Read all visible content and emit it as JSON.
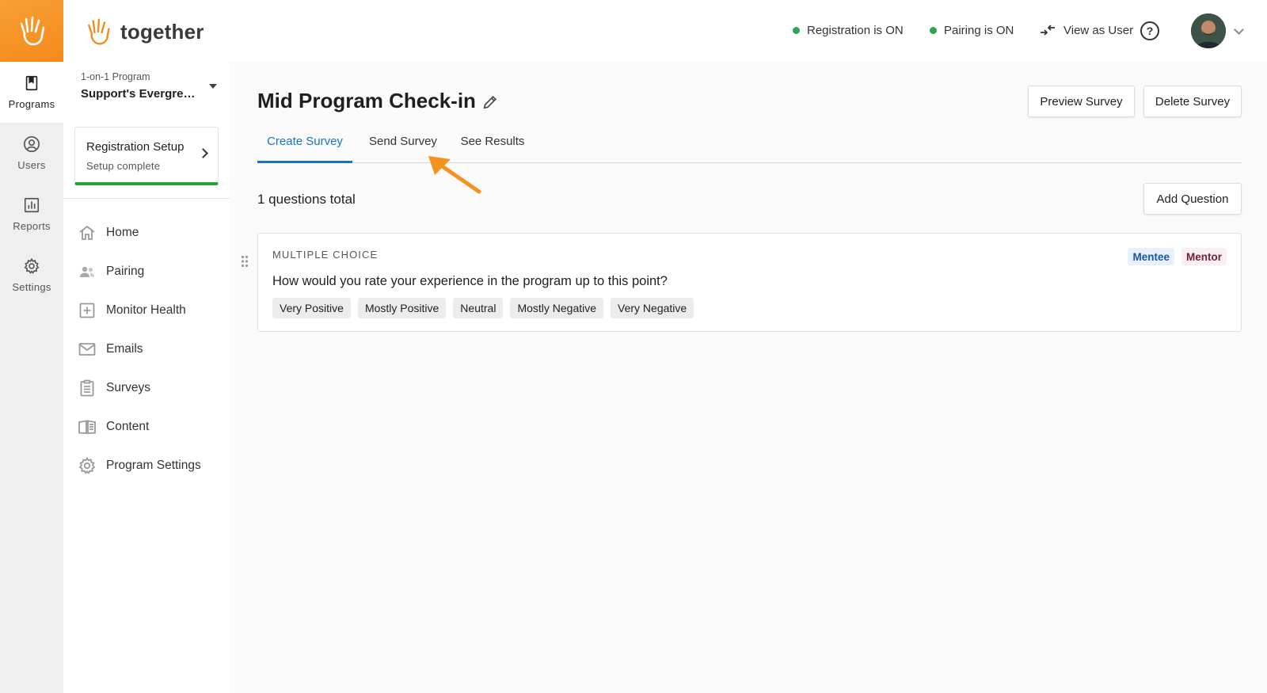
{
  "brand": {
    "name": "together",
    "color": "#f5891a"
  },
  "rail": {
    "items": [
      {
        "label": "Programs",
        "icon": "book-icon",
        "active": true
      },
      {
        "label": "Users",
        "icon": "user-circle-icon",
        "active": false
      },
      {
        "label": "Reports",
        "icon": "bar-chart-icon",
        "active": false
      },
      {
        "label": "Settings",
        "icon": "gear-icon",
        "active": false
      }
    ]
  },
  "sidebar": {
    "program_type": "1-on-1 Program",
    "program_name": "Support's Evergreen Mentorship Program",
    "registration": {
      "title": "Registration Setup",
      "status": "Setup complete"
    },
    "nav": [
      {
        "label": "Home",
        "icon": "home-icon"
      },
      {
        "label": "Pairing",
        "icon": "users-icon"
      },
      {
        "label": "Monitor Health",
        "icon": "health-plus-icon"
      },
      {
        "label": "Emails",
        "icon": "mail-icon"
      },
      {
        "label": "Surveys",
        "icon": "clipboard-icon"
      },
      {
        "label": "Content",
        "icon": "book-open-icon"
      },
      {
        "label": "Program Settings",
        "icon": "gear-icon"
      }
    ]
  },
  "topbar": {
    "registration_status": "Registration is ON",
    "pairing_status": "Pairing is ON",
    "view_as_user": "View as User",
    "help": "?",
    "status_color": "#2ea44f"
  },
  "survey": {
    "title": "Mid Program Check-in",
    "preview_label": "Preview Survey",
    "delete_label": "Delete Survey",
    "tabs": [
      {
        "label": "Create Survey",
        "active": true
      },
      {
        "label": "Send Survey",
        "active": false
      },
      {
        "label": "See Results",
        "active": false
      }
    ],
    "questions_total": "1 questions total",
    "add_question_label": "Add Question",
    "questions": [
      {
        "type": "MULTIPLE CHOICE",
        "text": "How would you rate your experience in the program up to this point?",
        "options": [
          "Very Positive",
          "Mostly Positive",
          "Neutral",
          "Mostly Negative",
          "Very Negative"
        ],
        "audiences": [
          "Mentee",
          "Mentor"
        ]
      }
    ]
  },
  "accent_color": "#1a73c8"
}
